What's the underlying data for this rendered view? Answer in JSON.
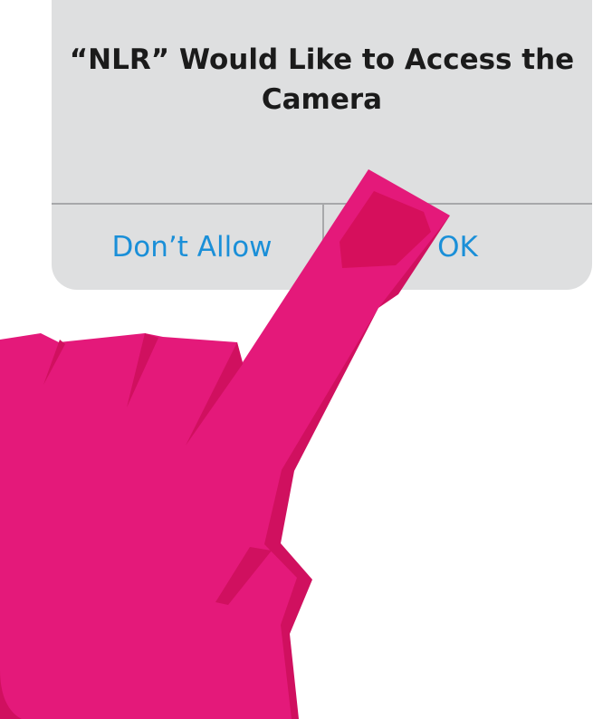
{
  "dialog": {
    "title": "“NLR” Would Like to Access the Camera",
    "deny_label": "Don’t Allow",
    "ok_label": "OK"
  },
  "colors": {
    "dialog_background": "#dedfe0",
    "button_text": "#1a8fd8",
    "hand": "#e4197a",
    "hand_shadow": "#d0105f",
    "fingernail": "#d60f5c"
  },
  "illustration": {
    "hand_icon": "pointing-hand-icon"
  }
}
